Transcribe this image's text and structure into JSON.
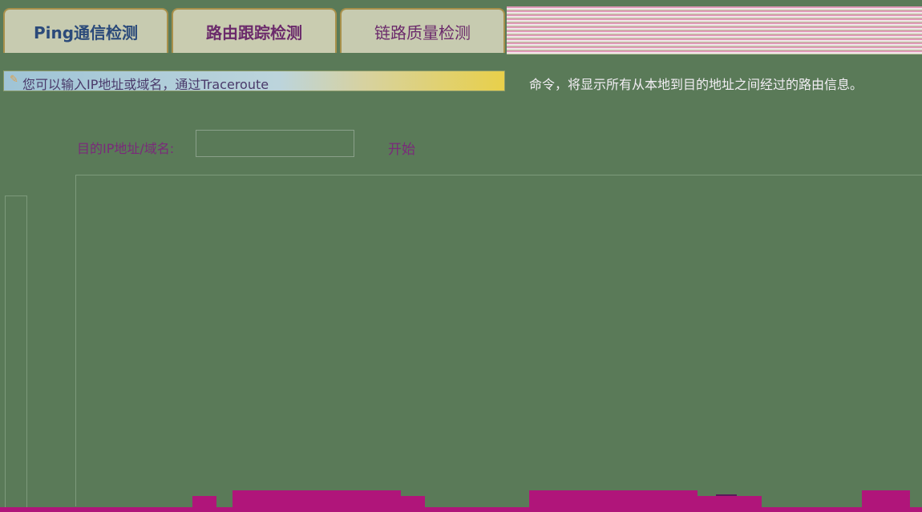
{
  "tabs": [
    {
      "label": "Ping通信检测",
      "active": false
    },
    {
      "label": "路由跟踪检测",
      "active": true
    },
    {
      "label": "链路质量检测",
      "active": false
    }
  ],
  "tip": {
    "left_text": "您可以输入IP地址或域名，通过Traceroute",
    "right_text": "命令，将显示所有从本地到目的地址之间经过的路由信息。"
  },
  "form": {
    "ip_label": "目的IP地址/域名:",
    "ip_value": "",
    "start_label": "开始"
  },
  "colors": {
    "background": "#5a7a58",
    "accent": "#b0157a",
    "label": "#7a2a7a"
  }
}
